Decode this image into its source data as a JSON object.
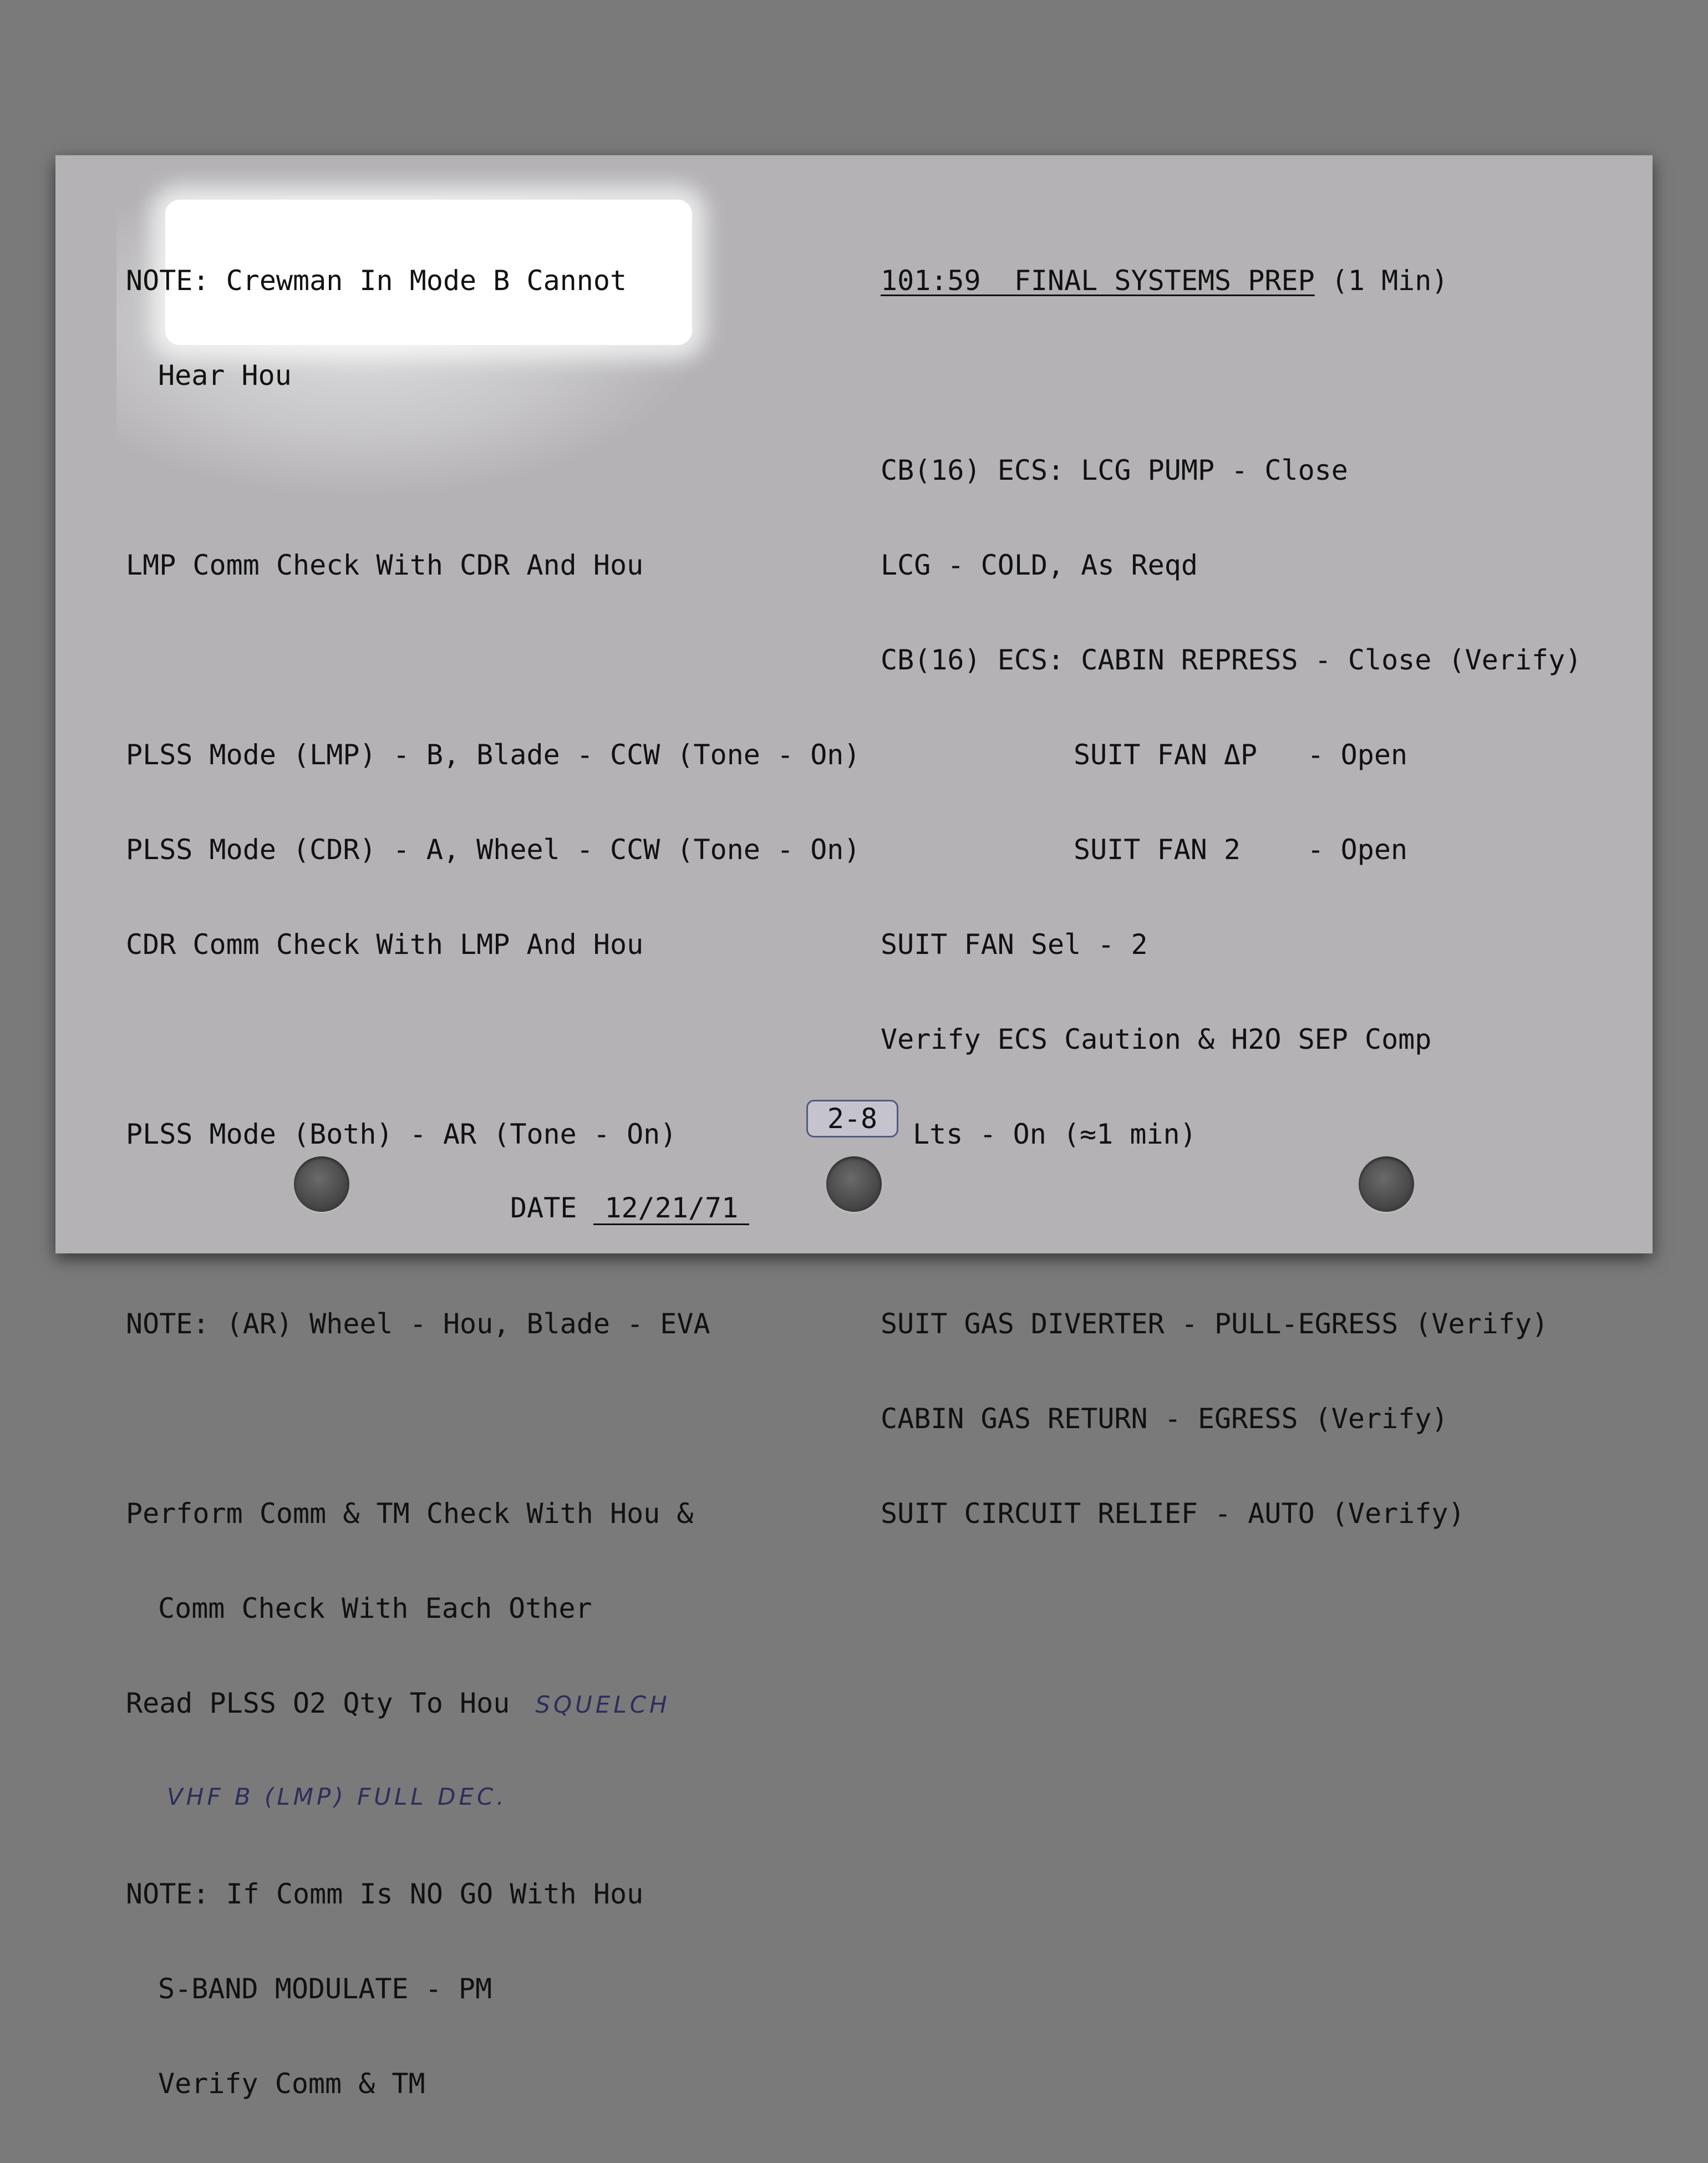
{
  "left_column": {
    "note_mode_b_1": "NOTE: Crewman In Mode B Cannot",
    "note_mode_b_2": "Hear Hou",
    "lmp_comm_check": "LMP Comm Check With CDR And Hou",
    "plss_mode_lmp": "PLSS Mode (LMP) - B, Blade - CCW (Tone - On)",
    "plss_mode_cdr": "PLSS Mode (CDR) - A, Wheel - CCW (Tone - On)",
    "cdr_comm_check": "CDR Comm Check With LMP And Hou",
    "plss_mode_both": "PLSS Mode (Both) - AR (Tone - On)",
    "note_ar": "NOTE: (AR) Wheel - Hou, Blade - EVA",
    "perform_1": "Perform Comm & TM Check With Hou &",
    "perform_2": "Comm Check With Each Other",
    "read_plss": "Read PLSS O2 Qty To Hou",
    "handwritten_1": "SQUELCH",
    "handwritten_2": "VHF B (LMP) FULL DEC.",
    "note_nogo": "NOTE: If Comm Is NO GO With Hou",
    "sband": "S-BAND MODULATE - PM",
    "verify_comm": "Verify Comm & TM"
  },
  "right_column": {
    "heading_time": "101:59  FINAL SYSTEMS PREP",
    "heading_duration": " (1 Min)",
    "cb_lcg_pump": "CB(16) ECS: LCG PUMP - Close",
    "lcg_cold": "LCG - COLD, As Reqd",
    "cb_cabin_repress": "CB(16) ECS: CABIN REPRESS - Close (Verify)",
    "suit_fan_dp": "SUIT FAN ΔP   - Open",
    "suit_fan_2": "SUIT FAN 2    - Open",
    "suit_fan_sel": "SUIT FAN Sel - 2",
    "verify_ecs_1": "Verify ECS Caution & H2O SEP Comp",
    "verify_ecs_2": "Lts - On (≈1 min)",
    "suit_gas_diverter": "SUIT GAS DIVERTER - PULL-EGRESS (Verify)",
    "cabin_gas_return": "CABIN GAS RETURN - EGRESS (Verify)",
    "suit_circuit_relief": "SUIT CIRCUIT RELIEF - AUTO (Verify)"
  },
  "footer": {
    "page_number": "2-8",
    "date_label": "DATE",
    "date_value": "12/21/71"
  },
  "colors": {
    "page_background": "#7a7a7a",
    "card": "#b4b2b5",
    "highlight": "#ffffff",
    "handwriting_ink": "#2d2d5c",
    "page_tab_border": "#555a80"
  }
}
